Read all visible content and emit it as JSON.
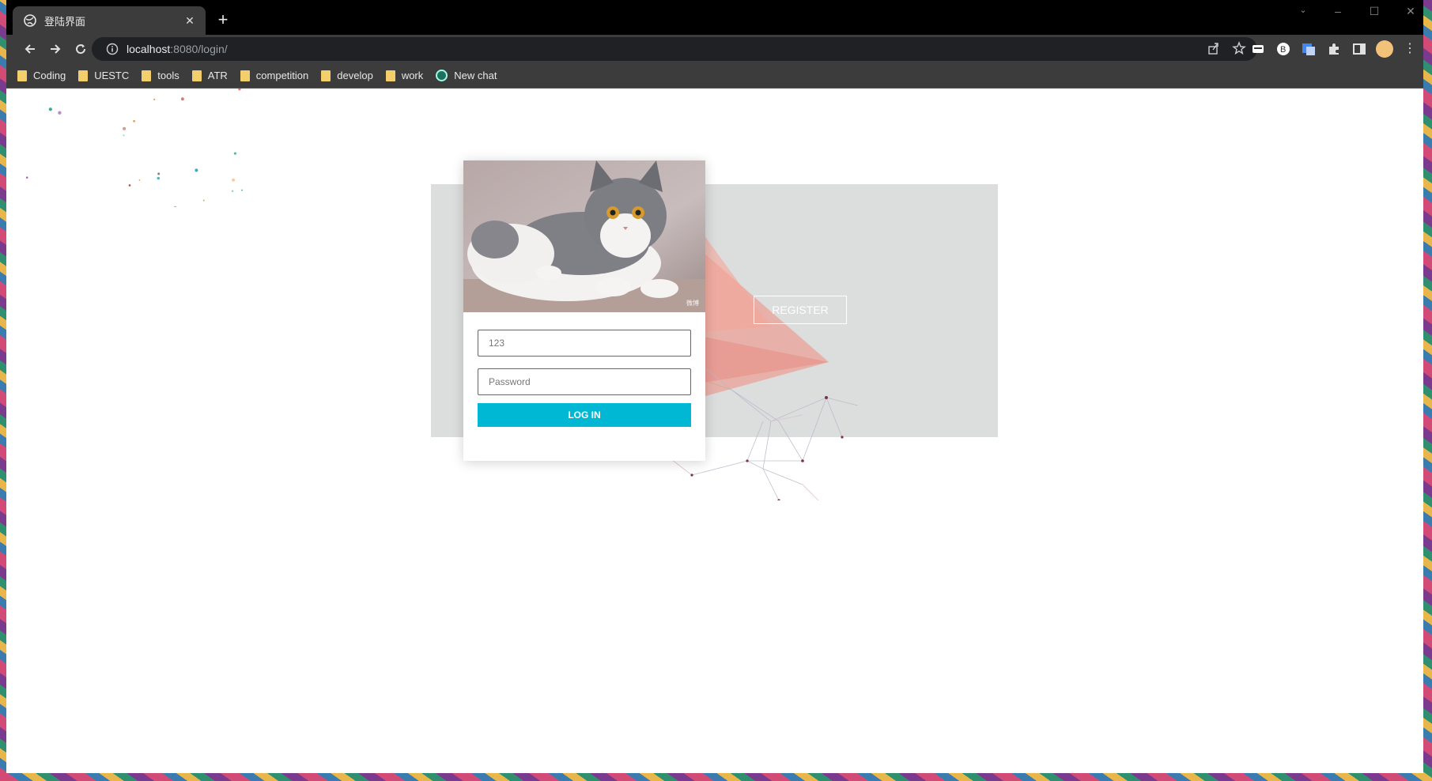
{
  "browser": {
    "tab": {
      "title": "登陆界面",
      "close": "✕"
    },
    "new_tab": "+",
    "window_controls": {
      "minimize": "–",
      "maximize": "☐",
      "close": "✕"
    },
    "url": {
      "host": "localhost",
      "path": ":8080/login/"
    },
    "bookmarks": [
      {
        "label": "Coding",
        "icon": "folder-icon"
      },
      {
        "label": "UESTC",
        "icon": "folder-icon"
      },
      {
        "label": "tools",
        "icon": "folder-icon"
      },
      {
        "label": "ATR",
        "icon": "folder-icon"
      },
      {
        "label": "competition",
        "icon": "folder-icon"
      },
      {
        "label": "develop",
        "icon": "folder-icon"
      },
      {
        "label": "work",
        "icon": "folder-icon"
      },
      {
        "label": "New chat",
        "icon": "chatgpt-icon"
      }
    ]
  },
  "login": {
    "username_value": "123",
    "password_placeholder": "Password",
    "login_button": "LOG IN",
    "register_button": "REGISTER",
    "photo_watermark": "微博"
  },
  "colors": {
    "accent": "#00b8d4",
    "panel": "#dcdddd",
    "triangle": "#f08a7e"
  }
}
